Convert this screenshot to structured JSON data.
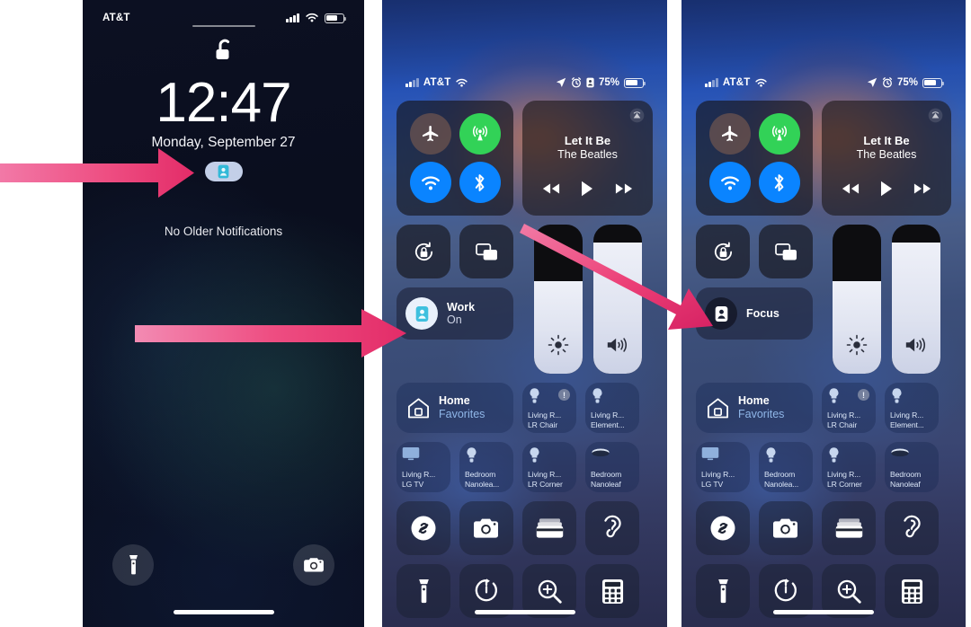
{
  "accent": {
    "arrow_pink": "#E8376F",
    "arrow_pink_light": "#F2679B"
  },
  "panels": [
    {
      "id": "lock-screen",
      "name": "iPhone Lock Screen",
      "status_bar": {
        "carrier": "AT&T",
        "signal_icon": "cellular-bars-icon",
        "wifi_icon": "wifi-icon",
        "battery_icon": "battery-icon",
        "battery_level_pct": 68
      },
      "padlock_icon": "unlocked-padlock-icon",
      "time": "12:47",
      "date": "Monday, September 27",
      "focus_pill": {
        "icon": "focus-person-badge-icon",
        "label": ""
      },
      "notifications_text": "No Older Notifications",
      "bottom_left_button": {
        "icon": "flashlight-icon",
        "label": ""
      },
      "bottom_right_button": {
        "icon": "camera-icon",
        "label": ""
      }
    },
    {
      "id": "control-center-focus-on",
      "name": "Control Center with Focus On",
      "status_bar": {
        "carrier": "AT&T",
        "signal_icon": "cellular-bars-icon",
        "wifi_icon": "wifi-icon",
        "location_icon": "location-arrow-icon",
        "alarm_icon": "alarm-clock-icon",
        "focus_icon": "focus-person-badge-icon",
        "battery_pct_label": "75%",
        "battery_icon": "battery-icon",
        "battery_level_pct": 75
      },
      "connectivity": {
        "airplane": {
          "icon": "airplane-icon",
          "state": "off"
        },
        "cellular": {
          "icon": "cellular-antenna-icon",
          "state": "on"
        },
        "wifi": {
          "icon": "wifi-icon",
          "state": "on"
        },
        "bluetooth": {
          "icon": "bluetooth-icon",
          "state": "on"
        }
      },
      "media": {
        "airplay_icon": "airplay-audio-icon",
        "title": "Let It Be",
        "artist": "The Beatles",
        "rewind_icon": "rewind-icon",
        "play_icon": "play-icon",
        "forward_icon": "fast-forward-icon"
      },
      "rotation_lock": {
        "icon": "rotation-lock-icon"
      },
      "screen_mirroring": {
        "icon": "screen-mirroring-icon"
      },
      "brightness_slider": {
        "icon": "brightness-sun-icon",
        "value_pct": 62
      },
      "volume_slider": {
        "icon": "volume-speaker-icon",
        "value_pct": 88
      },
      "focus_tile": {
        "icon": "focus-person-badge-icon",
        "name": "Work",
        "state": "On",
        "active": true
      },
      "home": {
        "icon": "home-house-icon",
        "name": "Home",
        "subtitle": "Favorites"
      },
      "devices": [
        {
          "icon": "lightbulb-icon",
          "line1": "Living R...",
          "line2": "LR Chair",
          "warning": "!"
        },
        {
          "icon": "lightbulb-icon",
          "line1": "Living R...",
          "line2": "Element...",
          "warning": ""
        },
        {
          "icon": "tv-icon",
          "line1": "Living R...",
          "line2": "LG TV",
          "warning": ""
        },
        {
          "icon": "lightbulb-icon",
          "line1": "Bedroom",
          "line2": "Nanolea...",
          "warning": ""
        },
        {
          "icon": "lightbulb-icon",
          "line1": "Living R...",
          "line2": "LR Corner",
          "warning": ""
        },
        {
          "icon": "nanoleaf-disc-icon",
          "line1": "Bedroom",
          "line2": "Nanoleaf",
          "warning": ""
        }
      ],
      "apps": [
        {
          "icon": "shazam-icon",
          "label": "Shazam"
        },
        {
          "icon": "camera-icon",
          "label": "Camera"
        },
        {
          "icon": "wallet-icon",
          "label": "Wallet"
        },
        {
          "icon": "hearing-ear-icon",
          "label": "Hearing"
        },
        {
          "icon": "flashlight-icon",
          "label": "Flashlight"
        },
        {
          "icon": "timer-icon",
          "label": "Timer"
        },
        {
          "icon": "magnifier-icon",
          "label": "Magnifier"
        },
        {
          "icon": "calculator-icon",
          "label": "Calculator"
        }
      ]
    },
    {
      "id": "control-center-focus-off",
      "name": "Control Center with Focus Off",
      "status_bar": {
        "carrier": "AT&T",
        "signal_icon": "cellular-bars-icon",
        "wifi_icon": "wifi-icon",
        "location_icon": "location-arrow-icon",
        "alarm_icon": "alarm-clock-icon",
        "battery_pct_label": "75%",
        "battery_icon": "battery-icon",
        "battery_level_pct": 75
      },
      "connectivity": {
        "airplane": {
          "icon": "airplane-icon",
          "state": "off"
        },
        "cellular": {
          "icon": "cellular-antenna-icon",
          "state": "on"
        },
        "wifi": {
          "icon": "wifi-icon",
          "state": "on"
        },
        "bluetooth": {
          "icon": "bluetooth-icon",
          "state": "on"
        }
      },
      "media": {
        "airplay_icon": "airplay-audio-icon",
        "title": "Let It Be",
        "artist": "The Beatles",
        "rewind_icon": "rewind-icon",
        "play_icon": "play-icon",
        "forward_icon": "fast-forward-icon"
      },
      "rotation_lock": {
        "icon": "rotation-lock-icon"
      },
      "screen_mirroring": {
        "icon": "screen-mirroring-icon"
      },
      "brightness_slider": {
        "icon": "brightness-sun-icon",
        "value_pct": 62
      },
      "volume_slider": {
        "icon": "volume-speaker-icon",
        "value_pct": 88
      },
      "focus_tile": {
        "icon": "focus-person-badge-icon",
        "name": "Focus",
        "state": "",
        "active": false
      },
      "home": {
        "icon": "home-house-icon",
        "name": "Home",
        "subtitle": "Favorites"
      },
      "devices": [
        {
          "icon": "lightbulb-icon",
          "line1": "Living R...",
          "line2": "LR Chair",
          "warning": "!"
        },
        {
          "icon": "lightbulb-icon",
          "line1": "Living R...",
          "line2": "Element...",
          "warning": ""
        },
        {
          "icon": "tv-icon",
          "line1": "Living R...",
          "line2": "LG TV",
          "warning": ""
        },
        {
          "icon": "lightbulb-icon",
          "line1": "Bedroom",
          "line2": "Nanolea...",
          "warning": ""
        },
        {
          "icon": "lightbulb-icon",
          "line1": "Living R...",
          "line2": "LR Corner",
          "warning": ""
        },
        {
          "icon": "nanoleaf-disc-icon",
          "line1": "Bedroom",
          "line2": "Nanoleaf",
          "warning": ""
        }
      ],
      "apps": [
        {
          "icon": "shazam-icon",
          "label": "Shazam"
        },
        {
          "icon": "camera-icon",
          "label": "Camera"
        },
        {
          "icon": "wallet-icon",
          "label": "Wallet"
        },
        {
          "icon": "hearing-ear-icon",
          "label": "Hearing"
        },
        {
          "icon": "flashlight-icon",
          "label": "Flashlight"
        },
        {
          "icon": "timer-icon",
          "label": "Timer"
        },
        {
          "icon": "magnifier-icon",
          "label": "Magnifier"
        },
        {
          "icon": "calculator-icon",
          "label": "Calculator"
        }
      ]
    }
  ],
  "annotations": [
    {
      "id": "arrow-to-lock-focus-pill",
      "shape": "arrow-right",
      "color": "#E8376F"
    },
    {
      "id": "arrow-to-work-focus-tile",
      "shape": "arrow-right",
      "color": "#E8376F"
    },
    {
      "id": "arrow-to-focus-off-tile",
      "shape": "arrow-diagonal-down-right",
      "color": "#E8376F"
    }
  ]
}
